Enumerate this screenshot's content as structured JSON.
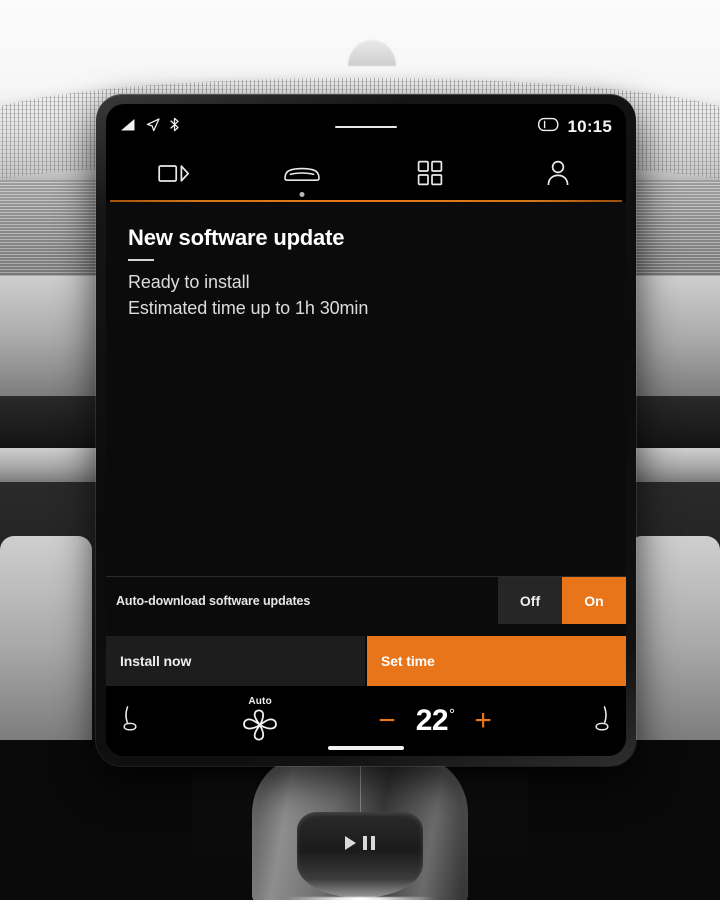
{
  "statusbar": {
    "icons": [
      "signal-bars-icon",
      "navigation-arrow-icon",
      "bluetooth-icon"
    ],
    "right_icons": [
      "key-fob-icon"
    ],
    "clock": "10:15"
  },
  "tabbar": {
    "tabs": [
      {
        "id": "media",
        "icon": "media-screen-icon",
        "active": false
      },
      {
        "id": "car",
        "icon": "car-front-icon",
        "active": true
      },
      {
        "id": "apps",
        "icon": "app-grid-icon",
        "active": false
      },
      {
        "id": "profile",
        "icon": "profile-icon",
        "active": false
      }
    ]
  },
  "content": {
    "title": "New software update",
    "status_line": "Ready to install",
    "estimate_line": "Estimated time up to 1h 30min"
  },
  "setting": {
    "label": "Auto-download software updates",
    "options": [
      {
        "label": "Off",
        "selected": false
      },
      {
        "label": "On",
        "selected": true
      }
    ]
  },
  "actions": {
    "secondary_label": "Install now",
    "primary_label": "Set time"
  },
  "climate": {
    "left_seat_icon": "seat-heater-left-icon",
    "fan": {
      "label": "Auto",
      "icon": "fan-auto-icon"
    },
    "decrease_label": "−",
    "temperature": "22",
    "degree_symbol": "°",
    "increase_label": "+",
    "right_seat_icon": "seat-heater-right-icon"
  },
  "console": {
    "shifter_glyph": "play-pause-icon"
  },
  "colors": {
    "accent_orange": "#e8751a",
    "screen_black": "#0b0b0b",
    "segment_off": "#262626",
    "button_secondary": "#1d1d1d"
  }
}
